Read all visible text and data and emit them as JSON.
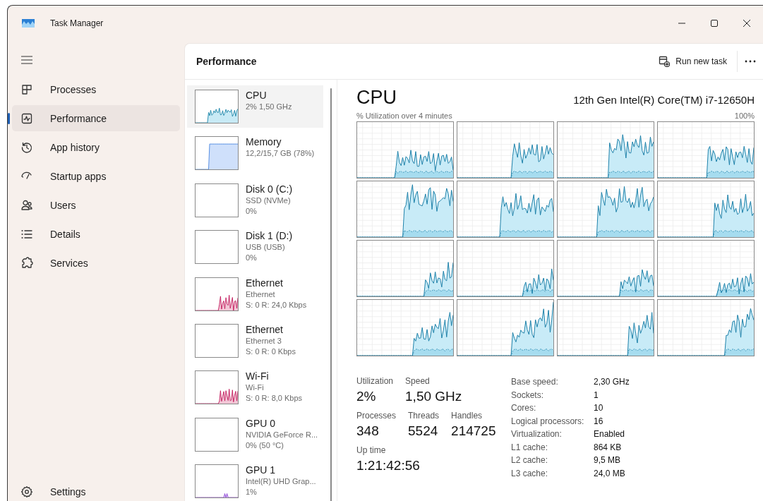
{
  "window": {
    "title": "Task Manager"
  },
  "sidebar": {
    "items": [
      {
        "label": "Processes",
        "selected": false
      },
      {
        "label": "Performance",
        "selected": true
      },
      {
        "label": "App history",
        "selected": false
      },
      {
        "label": "Startup apps",
        "selected": false
      },
      {
        "label": "Users",
        "selected": false
      },
      {
        "label": "Details",
        "selected": false
      },
      {
        "label": "Services",
        "selected": false
      }
    ],
    "footer": {
      "label": "Settings",
      "selected": false
    }
  },
  "header": {
    "title": "Performance",
    "action": "Run new task"
  },
  "devices": [
    {
      "kind": "cpu",
      "name": "CPU",
      "lines": [
        "2% 1,50 GHz"
      ],
      "activity": true,
      "selected": true
    },
    {
      "kind": "memory",
      "name": "Memory",
      "lines": [
        "12,2/15,7 GB (78%)"
      ],
      "activity": true,
      "selected": false
    },
    {
      "kind": "disk",
      "name": "Disk 0 (C:)",
      "lines": [
        "SSD (NVMe)",
        "0%"
      ],
      "activity": false,
      "selected": false
    },
    {
      "kind": "disk",
      "name": "Disk 1 (D:)",
      "lines": [
        "USB (USB)",
        "0%"
      ],
      "activity": false,
      "selected": false
    },
    {
      "kind": "network",
      "name": "Ethernet",
      "lines": [
        "Ethernet",
        "S: 0 R: 24,0 Kbps"
      ],
      "activity": true,
      "selected": false
    },
    {
      "kind": "network",
      "name": "Ethernet",
      "lines": [
        "Ethernet 3",
        "S: 0 R: 0 Kbps"
      ],
      "activity": false,
      "selected": false
    },
    {
      "kind": "network",
      "name": "Wi-Fi",
      "lines": [
        "Wi-Fi",
        "S: 0 R: 8,0 Kbps"
      ],
      "activity": true,
      "selected": false
    },
    {
      "kind": "gpu",
      "name": "GPU 0",
      "lines": [
        "NVIDIA GeForce R...",
        "0% (50 °C)"
      ],
      "activity": false,
      "selected": false
    },
    {
      "kind": "gpu",
      "name": "GPU 1",
      "lines": [
        "Intel(R) UHD Grap...",
        "1%"
      ],
      "activity": true,
      "selected": false
    }
  ],
  "cpu": {
    "title": "CPU",
    "model": "12th Gen Intel(R) Core(TM) i7-12650H",
    "graph_label": "% Utilization over 4 minutes",
    "graph_max": "100%",
    "stats": [
      [
        {
          "label": "Utilization",
          "value": "2%"
        },
        {
          "label": "Speed",
          "value": "1,50 GHz"
        }
      ],
      [
        {
          "label": "Processes",
          "value": "348"
        },
        {
          "label": "Threads",
          "value": "5524"
        },
        {
          "label": "Handles",
          "value": "214725"
        }
      ],
      [
        {
          "label": "Up time",
          "value": "1:21:42:56"
        }
      ]
    ],
    "specs": [
      {
        "label": "Base speed:",
        "value": "2,30 GHz"
      },
      {
        "label": "Sockets:",
        "value": "1"
      },
      {
        "label": "Cores:",
        "value": "10"
      },
      {
        "label": "Logical processors:",
        "value": "16"
      },
      {
        "label": "Virtualization:",
        "value": "Enabled"
      },
      {
        "label": "L1 cache:",
        "value": "864 KB"
      },
      {
        "label": "L2 cache:",
        "value": "9,5 MB"
      },
      {
        "label": "L3 cache:",
        "value": "24,0 MB"
      }
    ]
  }
}
